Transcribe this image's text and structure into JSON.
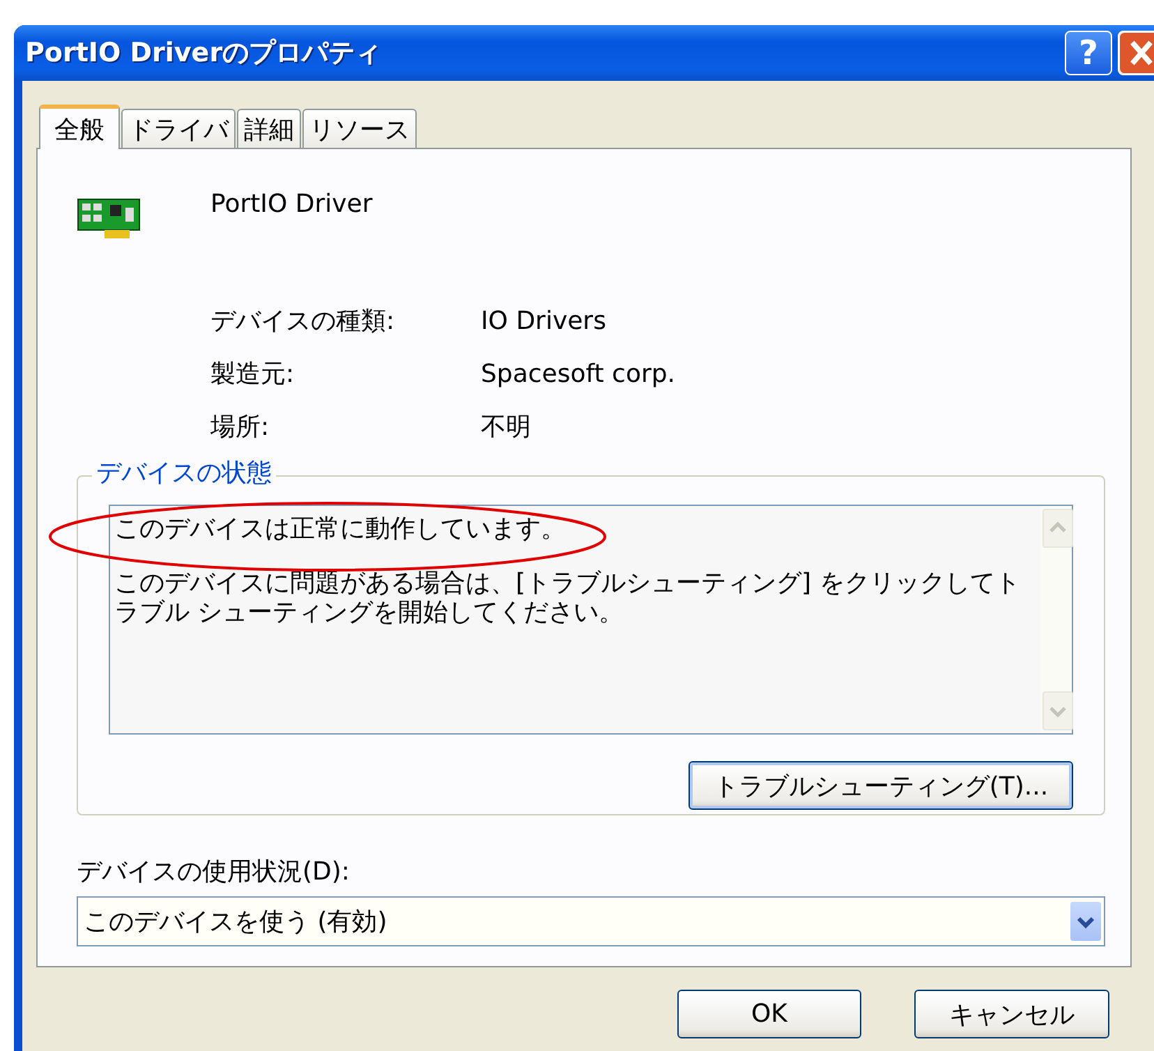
{
  "window": {
    "title": "PortIO Driverのプロパティ",
    "help_label": "?"
  },
  "tabs": [
    {
      "label": "全般",
      "selected": true
    },
    {
      "label": "ドライバ",
      "selected": false
    },
    {
      "label": "詳細",
      "selected": false
    },
    {
      "label": "リソース",
      "selected": false
    }
  ],
  "device": {
    "name": "PortIO Driver"
  },
  "properties": [
    {
      "label": "デバイスの種類:",
      "value": "IO Drivers"
    },
    {
      "label": "製造元:",
      "value": "Spacesoft corp."
    },
    {
      "label": "場所:",
      "value": "不明"
    }
  ],
  "status_group": {
    "legend": "デバイスの状態",
    "message": "このデバイスは正常に動作しています。",
    "help_text": "このデバイスに問題がある場合は、[トラブルシューティング] をクリックしてトラブル シューティングを開始してください。",
    "annotation": {
      "kind": "ellipse"
    }
  },
  "troubleshoot_button": {
    "label": "トラブルシューティング(T)..."
  },
  "usage": {
    "label": "デバイスの使用状況(D):",
    "value": "このデバイスを使う (有効)"
  },
  "buttons": [
    {
      "label": "OK"
    },
    {
      "label": "キャンセル"
    }
  ]
}
